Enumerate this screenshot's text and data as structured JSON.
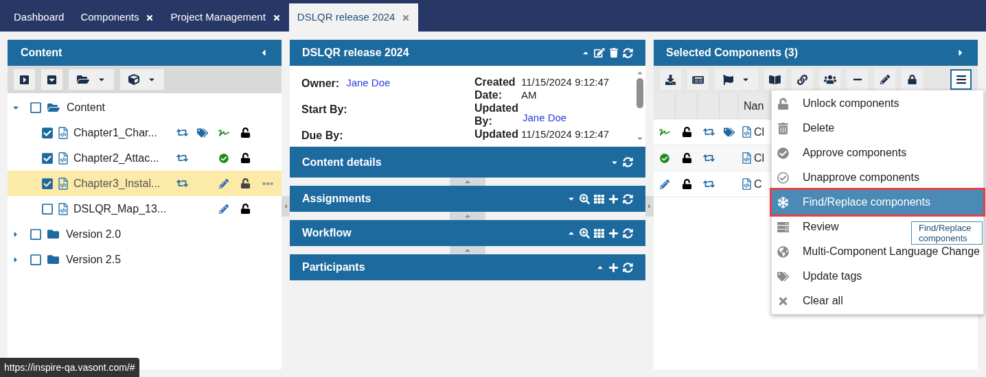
{
  "tabs": [
    {
      "label": "Dashboard",
      "closable": false,
      "selected": false
    },
    {
      "label": "Components",
      "closable": true,
      "selected": false
    },
    {
      "label": "Project Management",
      "closable": true,
      "selected": false
    },
    {
      "label": "DSLQR release 2024",
      "closable": true,
      "selected": true
    }
  ],
  "content_panel": {
    "title": "Content",
    "tree": [
      {
        "label": "Content",
        "kind": "folder",
        "expanded": true,
        "checked": false,
        "children": [
          {
            "label": "Chapter1_Char...",
            "kind": "file",
            "checked": true,
            "selected": false,
            "synced": true,
            "tagged": true,
            "signed": true,
            "approved": false,
            "editing": false,
            "locked": false
          },
          {
            "label": "Chapter2_Attac...",
            "kind": "file",
            "checked": true,
            "selected": false,
            "synced": true,
            "tagged": false,
            "signed": false,
            "approved": true,
            "editing": false,
            "locked": false
          },
          {
            "label": "Chapter3_Instal...",
            "kind": "file",
            "checked": true,
            "selected": true,
            "synced": true,
            "tagged": false,
            "signed": false,
            "approved": false,
            "editing": true,
            "locked": false
          },
          {
            "label": "DSLQR_Map_13...",
            "kind": "file",
            "checked": false,
            "selected": false,
            "synced": false,
            "tagged": false,
            "signed": false,
            "approved": false,
            "editing": true,
            "locked": false
          }
        ]
      },
      {
        "label": "Version 2.0",
        "kind": "folder",
        "expanded": false,
        "checked": false
      },
      {
        "label": "Version 2.5",
        "kind": "folder",
        "expanded": false,
        "checked": false
      }
    ]
  },
  "project_panel": {
    "title": "DSLQR release 2024",
    "left_fields": [
      {
        "label": "Owner:",
        "value": "Jane Doe",
        "link": true
      },
      {
        "label": "Start By:"
      },
      {
        "label": "Due By:"
      }
    ],
    "right_fields": [
      {
        "label": "Created Date:",
        "value": "11/15/2024 9:12:47 AM",
        "link": false
      },
      {
        "label": "Updated By:",
        "value": "Jane Doe",
        "link": true
      },
      {
        "label": "Updated",
        "value": "11/15/2024 9:12:47",
        "link": false
      }
    ],
    "sections": [
      {
        "title": "Content details",
        "expanded": false,
        "searchable": false,
        "addable": false
      },
      {
        "title": "Assignments",
        "expanded": false,
        "searchable": true,
        "addable": true
      },
      {
        "title": "Workflow",
        "expanded": true,
        "searchable": true,
        "addable": true
      },
      {
        "title": "Participants",
        "expanded": true,
        "searchable": false,
        "addable": true
      }
    ]
  },
  "selected_panel": {
    "title": "Selected Components (3)",
    "name_column": "Nan",
    "rows": [
      {
        "signed": true,
        "approved": false,
        "editing": false,
        "locked": false,
        "synced": true,
        "tagged": true,
        "name": "Cl"
      },
      {
        "signed": false,
        "approved": true,
        "editing": false,
        "locked": false,
        "synced": true,
        "tagged": false,
        "name": "Cl"
      },
      {
        "signed": false,
        "approved": false,
        "editing": true,
        "locked": false,
        "synced": true,
        "tagged": false,
        "name": "C"
      }
    ]
  },
  "menu": {
    "items": [
      {
        "label": "Unlock components",
        "selected": false
      },
      {
        "label": "Delete",
        "selected": false
      },
      {
        "label": "Approve components",
        "selected": false
      },
      {
        "label": "Unapprove components",
        "selected": false
      },
      {
        "label": "Find/Replace components",
        "selected": true
      },
      {
        "label": "Review",
        "selected": false
      },
      {
        "label": "Multi-Component Language Change",
        "selected": false
      },
      {
        "label": "Update tags",
        "selected": false
      },
      {
        "label": "Clear all",
        "selected": false
      }
    ],
    "tooltip": "Find/Replace components"
  },
  "status_bar": "https://inspire-qa.vasont.com/#"
}
